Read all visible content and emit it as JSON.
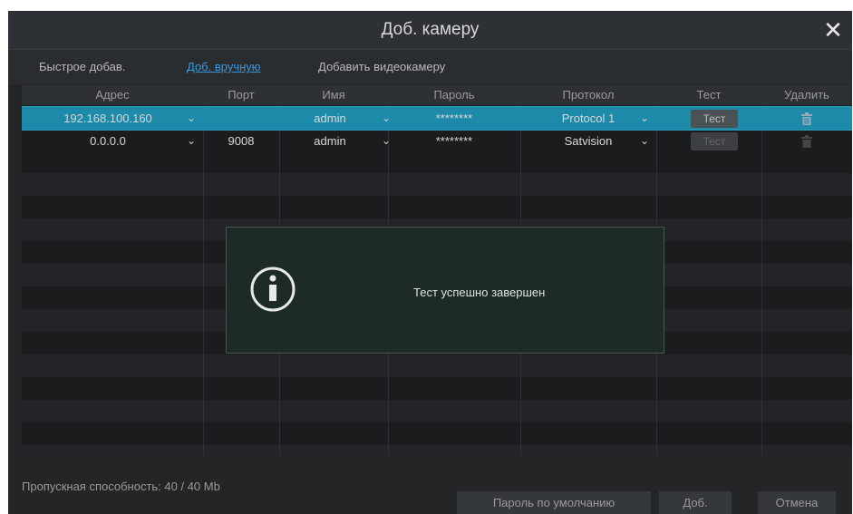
{
  "dialog": {
    "title": "Доб. камеру",
    "close_symbol": "✕"
  },
  "tabs": [
    {
      "label": "Быстрое добав.",
      "active": false
    },
    {
      "label": "Доб. вручную",
      "active": true
    },
    {
      "label": "Добавить видеокамеру",
      "active": false
    }
  ],
  "table": {
    "headers": [
      "Адрес",
      "Порт",
      "Имя",
      "Пароль",
      "Протокол",
      "Тест",
      "Удалить"
    ],
    "rows": [
      {
        "address": "192.168.100.160",
        "port": "",
        "name": "admin",
        "password": "********",
        "protocol": "Protocol 1",
        "test_label": "Тест",
        "selected": true
      },
      {
        "address": "0.0.0.0",
        "port": "9008",
        "name": "admin",
        "password": "********",
        "protocol": "Satvision",
        "test_label": "Тест",
        "selected": false
      }
    ]
  },
  "modal": {
    "message": "Тест успешно завершен",
    "icon": "info-circle-icon"
  },
  "footer": {
    "bandwidth": "Пропускная способность: 40 / 40 Mb",
    "default_password_button": "Пароль по умолчанию",
    "add_button": "Доб.",
    "cancel_button": "Отмена"
  },
  "colors": {
    "selected_row": "#1c8aa8",
    "active_tab": "#3a98e0",
    "background": "#232527"
  }
}
